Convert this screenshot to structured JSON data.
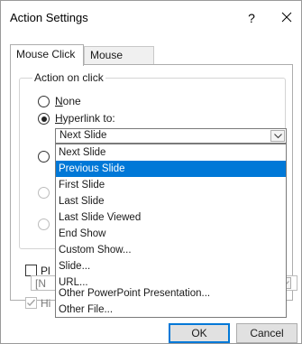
{
  "dialog": {
    "title": "Action Settings",
    "help_label": "?",
    "close_icon": "close-icon"
  },
  "tabs": [
    {
      "label": "Mouse Click",
      "active": true
    },
    {
      "label": "Mouse Over",
      "active": false
    }
  ],
  "action_group": {
    "label": "Action on click",
    "options": {
      "none": {
        "prefix": "",
        "mnemonic": "N",
        "rest": "one",
        "checked": false
      },
      "hyperlink": {
        "mnemonic": "H",
        "rest": "yperlink to:",
        "checked": true
      },
      "run_program_partial": {
        "visible": true
      },
      "run_macro_partial": {
        "visible": true,
        "disabled": true
      },
      "object_action_partial": {
        "visible": true,
        "disabled": true
      }
    },
    "hyperlink_value": "Next Slide"
  },
  "dropdown": {
    "items": [
      "Next Slide",
      "Previous Slide",
      "First Slide",
      "Last Slide",
      "Last Slide Viewed",
      "End Show",
      "Custom Show...",
      "Slide...",
      "URL...",
      "Other PowerPoint Presentation...",
      "Other File..."
    ],
    "selected_index": 1
  },
  "play_sound": {
    "label_partial": "Pl",
    "checked": false,
    "sound_box_partial": "[N"
  },
  "highlight": {
    "label_partial": "Hi",
    "checked": true,
    "disabled": true
  },
  "buttons": {
    "ok": "OK",
    "cancel": "Cancel"
  },
  "colors": {
    "accent": "#0078d7",
    "selected_text": "#ffffff"
  }
}
